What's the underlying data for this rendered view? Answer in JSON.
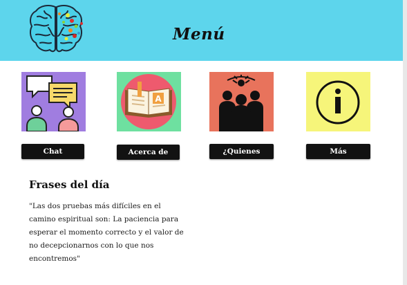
{
  "header": {
    "title": "Menú",
    "logo_icon": "brain-icon",
    "background": "#5dd5ec"
  },
  "cards": [
    {
      "label": "Chat",
      "icon": "chat-icon",
      "bg": "#a07de0"
    },
    {
      "label": "Acerca de",
      "icon": "book-icon",
      "bg": "#6ee0a0"
    },
    {
      "label": "¿Quienes somos?",
      "icon": "team-icon",
      "bg": "#e8735c"
    },
    {
      "label": "Más información",
      "icon": "info-icon",
      "bg": "#f6f57a"
    }
  ],
  "phrases": {
    "title": "Frases del día",
    "quote": "\"Las dos pruebas más difíciles en el camino espiritual son: La paciencia para esperar el momento correcto y el valor de no decepcionarnos con lo que nos encontremos\""
  }
}
